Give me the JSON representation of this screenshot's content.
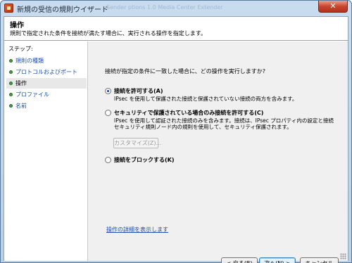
{
  "window": {
    "title": "新規の受信の規則ウイザード",
    "background_title_fragment": "Sender  ptions 1.0   Media Center Extender",
    "close_glyph": "✕"
  },
  "header": {
    "title": "操作",
    "subtitle": "規則で指定された条件を接続が満たす場合に、実行される操作を指定します。"
  },
  "steps": {
    "heading": "ステップ:",
    "items": [
      {
        "label": "規則の種類",
        "state": "link"
      },
      {
        "label": "プロトコルおよびポート",
        "state": "link"
      },
      {
        "label": "操作",
        "state": "current"
      },
      {
        "label": "プロファイル",
        "state": "link"
      },
      {
        "label": "名前",
        "state": "link"
      }
    ]
  },
  "main": {
    "question": "接続が指定の条件に一致した場合に、どの操作を実行しますか?",
    "options": [
      {
        "label": "接続を許可する(A)",
        "selected": true,
        "description": [
          "IPsec を使用して保護された接続と保護されていない接続の両方を含みます。"
        ]
      },
      {
        "label": "セキュリティで保護されている場合のみ接続を許可する(C)",
        "selected": false,
        "description": [
          "IPsec を使用して認証された接続のみを含みます。接続は、IPsec プロパティ内の設定と接続",
          "セキュリティ規則ノード内の規則を使用して、セキュリティ保護されます。"
        ]
      },
      {
        "label": "接続をブロックする(K)",
        "selected": false,
        "description": []
      }
    ],
    "customize_button": "カスタマイズ(Z)...",
    "detail_link": "操作の詳細を表示します"
  },
  "buttons": {
    "back": "< 戻る(B)",
    "next": "次へ(N) >",
    "cancel": "キャンセル"
  },
  "colors": {
    "link": "#1a4fb0",
    "step_bullet": "#3aa33a",
    "main_bg": "#f0f0f0",
    "frame": "#c9dcef"
  }
}
